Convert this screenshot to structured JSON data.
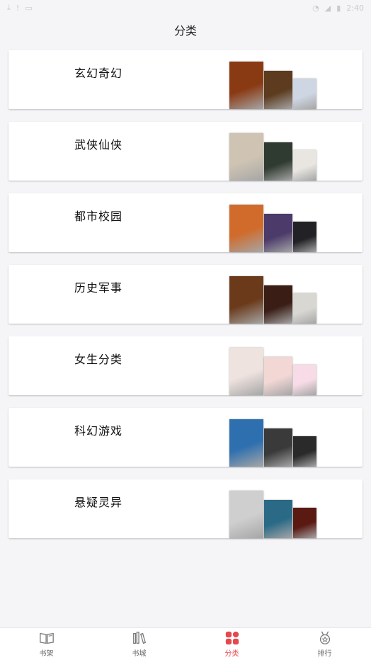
{
  "statusbar": {
    "time": "2:40"
  },
  "header": {
    "title": "分类"
  },
  "categories": [
    {
      "label": "玄幻奇幻",
      "covers": [
        "#8a3a12",
        "#5c3b1e",
        "#cdd6e2"
      ]
    },
    {
      "label": "武侠仙侠",
      "covers": [
        "#cfc4b3",
        "#2f3a30",
        "#e9e6e1"
      ]
    },
    {
      "label": "都市校园",
      "covers": [
        "#d06b2c",
        "#4b3a6a",
        "#222226"
      ]
    },
    {
      "label": "历史军事",
      "covers": [
        "#6a3a1a",
        "#3a1e16",
        "#d9d7d2"
      ]
    },
    {
      "label": "女生分类",
      "covers": [
        "#efe3df",
        "#f2d7d5",
        "#f7dbe6"
      ]
    },
    {
      "label": "科幻游戏",
      "covers": [
        "#2e6fb0",
        "#3a3a3a",
        "#2a2a2a"
      ]
    },
    {
      "label": "悬疑灵异",
      "covers": [
        "#cfcfcf",
        "#2a6a86",
        "#5a1a12"
      ]
    }
  ],
  "tabbar": {
    "items": [
      {
        "label": "书架",
        "icon": "book-open-icon"
      },
      {
        "label": "书城",
        "icon": "bookshelf-icon"
      },
      {
        "label": "分类",
        "icon": "category-grid-icon",
        "active": true
      },
      {
        "label": "排行",
        "icon": "medal-icon"
      }
    ],
    "active_color": "#e5494d",
    "inactive_color": "#666666"
  }
}
